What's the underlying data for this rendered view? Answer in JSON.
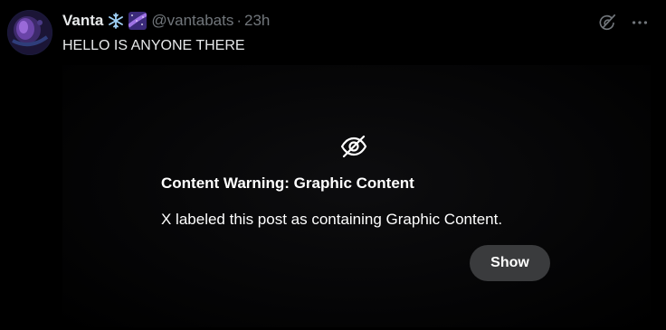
{
  "post": {
    "display_name": "Vanta",
    "emojis": [
      "snowflake-emoji",
      "milky-way-emoji"
    ],
    "handle": "@vantabats",
    "separator": "·",
    "timestamp": "23h",
    "text": "HELLO IS ANYONE THERE",
    "icons": {
      "grok": "grok-icon",
      "more": "more-icon"
    }
  },
  "content_warning": {
    "icon": "eye-slash-icon",
    "title": "Content Warning: Graphic Content",
    "description": "X labeled this post as containing Graphic Content.",
    "show_label": "Show"
  },
  "colors": {
    "background": "#000000",
    "primary_text": "#e7e9ea",
    "secondary_text": "#71767b",
    "button_bg": "#3a3b3d"
  }
}
